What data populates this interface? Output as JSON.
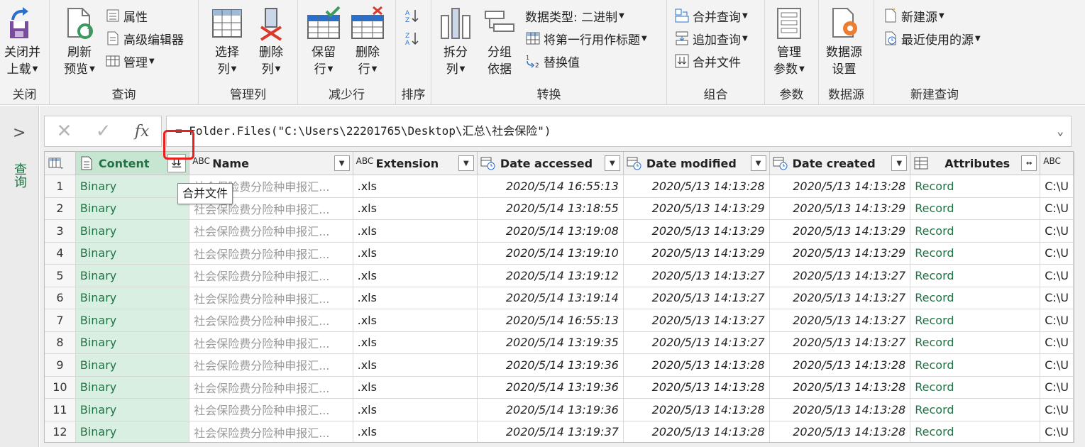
{
  "ribbon": {
    "groups": {
      "close": "关闭",
      "query": "查询",
      "manage_cols": "管理列",
      "reduce_rows": "减少行",
      "sort": "排序",
      "transform": "转换",
      "combine": "组合",
      "params": "参数",
      "datasource": "数据源",
      "new_query": "新建查询"
    },
    "close_load": [
      "关闭并",
      "上载"
    ],
    "refresh_preview": [
      "刷新",
      "预览"
    ],
    "properties": "属性",
    "advanced_editor": "高级编辑器",
    "manage": "管理",
    "choose_cols": [
      "选择",
      "列"
    ],
    "remove_cols": [
      "删除",
      "列"
    ],
    "keep_rows": [
      "保留",
      "行"
    ],
    "remove_rows": [
      "删除",
      "行"
    ],
    "split_col": [
      "拆分",
      "列"
    ],
    "group_by": [
      "分组",
      "依据"
    ],
    "data_type": "数据类型: 二进制",
    "first_row_header": "将第一行用作标题",
    "replace_values": "替换值",
    "merge_queries": "合并查询",
    "append_queries": "追加查询",
    "combine_files": "合并文件",
    "manage_params": [
      "管理",
      "参数"
    ],
    "datasource_settings": [
      "数据源",
      "设置"
    ],
    "new_source": "新建源",
    "recent_sources": "最近使用的源"
  },
  "nav": {
    "label": "查询"
  },
  "formula": "= Folder.Files(\"C:\\Users\\22201765\\Desktop\\汇总\\社会保险\")",
  "tooltip": "合并文件",
  "columns": [
    "Content",
    "Name",
    "Extension",
    "Date accessed",
    "Date modified",
    "Date created",
    "Attributes",
    ""
  ],
  "rows": [
    {
      "n": "1",
      "content": "Binary",
      "name": "社会保险费分险种申报汇...",
      "ext": ".xls",
      "accessed": "2020/5/14 16:55:13",
      "modified": "2020/5/13 14:13:28",
      "created": "2020/5/13 14:13:28",
      "attr": "Record",
      "path": "C:\\U"
    },
    {
      "n": "2",
      "content": "Binary",
      "name": "社会保险费分险种申报汇...",
      "ext": ".xls",
      "accessed": "2020/5/14 13:18:55",
      "modified": "2020/5/13 14:13:29",
      "created": "2020/5/13 14:13:29",
      "attr": "Record",
      "path": "C:\\U"
    },
    {
      "n": "3",
      "content": "Binary",
      "name": "社会保险费分险种申报汇...",
      "ext": ".xls",
      "accessed": "2020/5/14 13:19:08",
      "modified": "2020/5/13 14:13:29",
      "created": "2020/5/13 14:13:29",
      "attr": "Record",
      "path": "C:\\U"
    },
    {
      "n": "4",
      "content": "Binary",
      "name": "社会保险费分险种申报汇...",
      "ext": ".xls",
      "accessed": "2020/5/14 13:19:10",
      "modified": "2020/5/13 14:13:29",
      "created": "2020/5/13 14:13:29",
      "attr": "Record",
      "path": "C:\\U"
    },
    {
      "n": "5",
      "content": "Binary",
      "name": "社会保险费分险种申报汇...",
      "ext": ".xls",
      "accessed": "2020/5/14 13:19:12",
      "modified": "2020/5/13 14:13:27",
      "created": "2020/5/13 14:13:27",
      "attr": "Record",
      "path": "C:\\U"
    },
    {
      "n": "6",
      "content": "Binary",
      "name": "社会保险费分险种申报汇...",
      "ext": ".xls",
      "accessed": "2020/5/14 13:19:14",
      "modified": "2020/5/13 14:13:27",
      "created": "2020/5/13 14:13:27",
      "attr": "Record",
      "path": "C:\\U"
    },
    {
      "n": "7",
      "content": "Binary",
      "name": "社会保险费分险种申报汇...",
      "ext": ".xls",
      "accessed": "2020/5/14 16:55:13",
      "modified": "2020/5/13 14:13:27",
      "created": "2020/5/13 14:13:27",
      "attr": "Record",
      "path": "C:\\U"
    },
    {
      "n": "8",
      "content": "Binary",
      "name": "社会保险费分险种申报汇...",
      "ext": ".xls",
      "accessed": "2020/5/14 13:19:35",
      "modified": "2020/5/13 14:13:27",
      "created": "2020/5/13 14:13:27",
      "attr": "Record",
      "path": "C:\\U"
    },
    {
      "n": "9",
      "content": "Binary",
      "name": "社会保险费分险种申报汇...",
      "ext": ".xls",
      "accessed": "2020/5/14 13:19:36",
      "modified": "2020/5/13 14:13:28",
      "created": "2020/5/13 14:13:28",
      "attr": "Record",
      "path": "C:\\U"
    },
    {
      "n": "10",
      "content": "Binary",
      "name": "社会保险费分险种申报汇...",
      "ext": ".xls",
      "accessed": "2020/5/14 13:19:36",
      "modified": "2020/5/13 14:13:28",
      "created": "2020/5/13 14:13:28",
      "attr": "Record",
      "path": "C:\\U"
    },
    {
      "n": "11",
      "content": "Binary",
      "name": "社会保险费分险种申报汇...",
      "ext": ".xls",
      "accessed": "2020/5/14 13:19:36",
      "modified": "2020/5/13 14:13:28",
      "created": "2020/5/13 14:13:28",
      "attr": "Record",
      "path": "C:\\U"
    },
    {
      "n": "12",
      "content": "Binary",
      "name": "社会保险费分险种申报汇...",
      "ext": ".xls",
      "accessed": "2020/5/14 13:19:37",
      "modified": "2020/5/13 14:13:28",
      "created": "2020/5/13 14:13:28",
      "attr": "Record",
      "path": "C:\\U"
    }
  ],
  "colors": {
    "accent_green": "#217346",
    "content_bg": "#d9efe1",
    "highlight_red": "#e8201e"
  }
}
